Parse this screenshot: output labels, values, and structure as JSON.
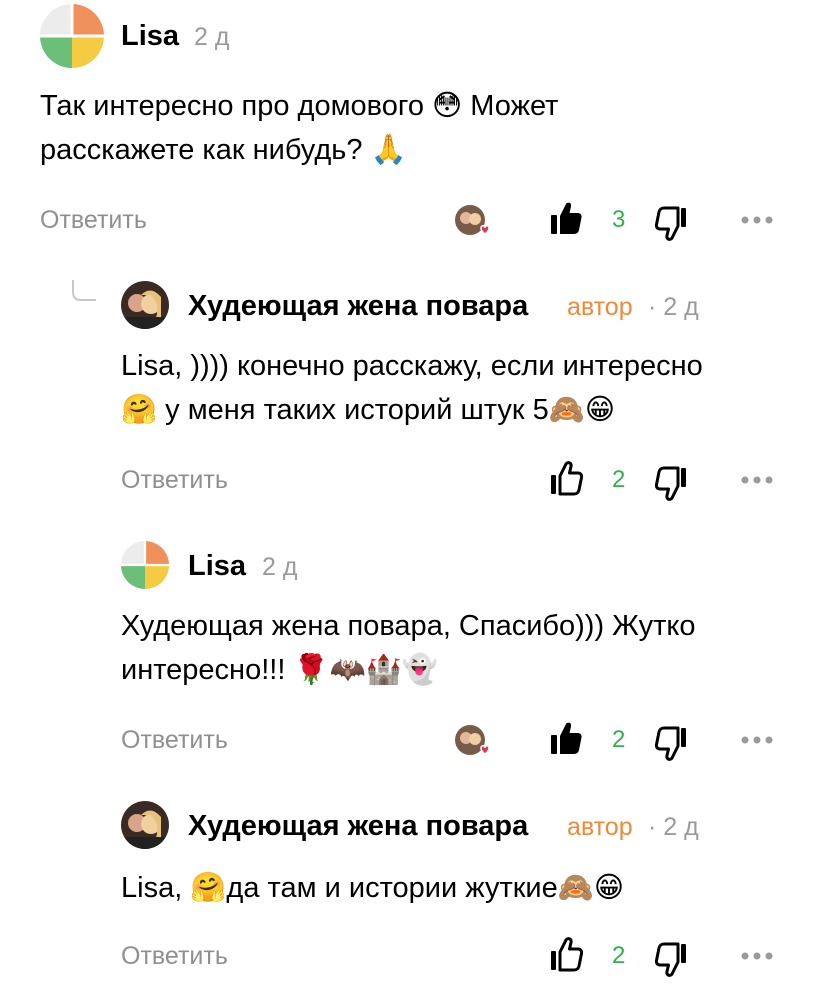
{
  "comments": [
    {
      "author": "Lisa",
      "time": "2 д",
      "text_line1": "Так интересно про домового 😳 Может",
      "text_line2": "расскажете как нибудь? 🙏",
      "reply_label": "Ответить",
      "likes": "3",
      "liked": true
    },
    {
      "author": "Худеющая жена повара",
      "author_tag": "автор",
      "time": "· 2 д",
      "text_line1": "Lisa, )))) конечно расскажу, если интересно",
      "text_line2": "🤗 у меня таких историй штук 5🙈😁",
      "reply_label": "Ответить",
      "likes": "2",
      "liked": false
    },
    {
      "author": "Lisa",
      "time": "2 д",
      "text_line1": "Худеющая жена повара, Спасибо))) Жутко",
      "text_line2": "интересно!!! 🌹🦇🏰👻",
      "reply_label": "Ответить",
      "likes": "2",
      "liked": true
    },
    {
      "author": "Худеющая жена повара",
      "author_tag": "автор",
      "time": "· 2 д",
      "text_line1": "Lisa, 🤗да там и истории жуткие🙈😁",
      "reply_label": "Ответить",
      "likes": "2",
      "liked": false
    }
  ],
  "colors": {
    "like_count": "#2fb24a",
    "author_tag": "#f08a3a",
    "muted": "#8f8f8f"
  }
}
